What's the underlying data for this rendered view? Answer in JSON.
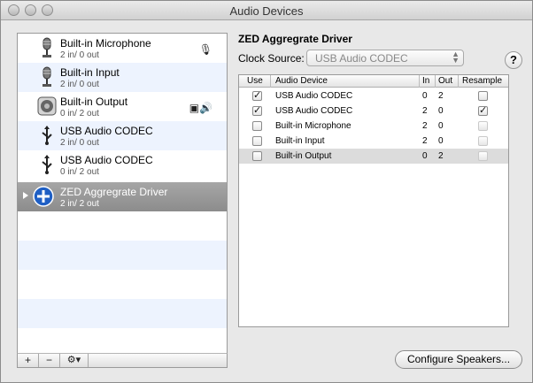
{
  "window": {
    "title": "Audio Devices"
  },
  "devices": [
    {
      "name": "Built-in Microphone",
      "io": "2 in/ 0 out",
      "icon": "microphone-icon",
      "badge": "🎙"
    },
    {
      "name": "Built-in Input",
      "io": "2 in/ 0 out",
      "icon": "microphone-icon",
      "badge": ""
    },
    {
      "name": "Built-in Output",
      "io": "0 in/ 2 out",
      "icon": "speaker-icon",
      "badge": "▣🔊"
    },
    {
      "name": "USB Audio CODEC",
      "io": "2 in/ 0 out",
      "icon": "usb-icon",
      "badge": ""
    },
    {
      "name": "USB Audio CODEC",
      "io": "0 in/ 2 out",
      "icon": "usb-icon",
      "badge": ""
    },
    {
      "name": "ZED Aggregrate Driver",
      "io": "2 in/ 2 out",
      "icon": "aggregate-plus-icon",
      "badge": ""
    }
  ],
  "list_toolbar": {
    "add": "+",
    "remove": "−",
    "gear": "⚙▾"
  },
  "aggregate": {
    "title": "ZED Aggregrate Driver",
    "clock_label": "Clock Source:",
    "clock_value": "USB Audio CODEC"
  },
  "help": "?",
  "table": {
    "headers": {
      "use": "Use",
      "device": "Audio Device",
      "in": "In",
      "out": "Out",
      "resample": "Resample"
    },
    "rows": [
      {
        "use": "✓",
        "device": "USB Audio CODEC",
        "in": "0",
        "out": "2",
        "resample": ""
      },
      {
        "use": "✓",
        "device": "USB Audio CODEC",
        "in": "2",
        "out": "0",
        "resample": "✓"
      },
      {
        "use": "",
        "device": "Built-in Microphone",
        "in": "2",
        "out": "0",
        "resample": ""
      },
      {
        "use": "",
        "device": "Built-in Input",
        "in": "2",
        "out": "0",
        "resample": ""
      },
      {
        "use": "",
        "device": "Built-in Output",
        "in": "0",
        "out": "2",
        "resample": ""
      }
    ]
  },
  "configure_button": "Configure Speakers..."
}
